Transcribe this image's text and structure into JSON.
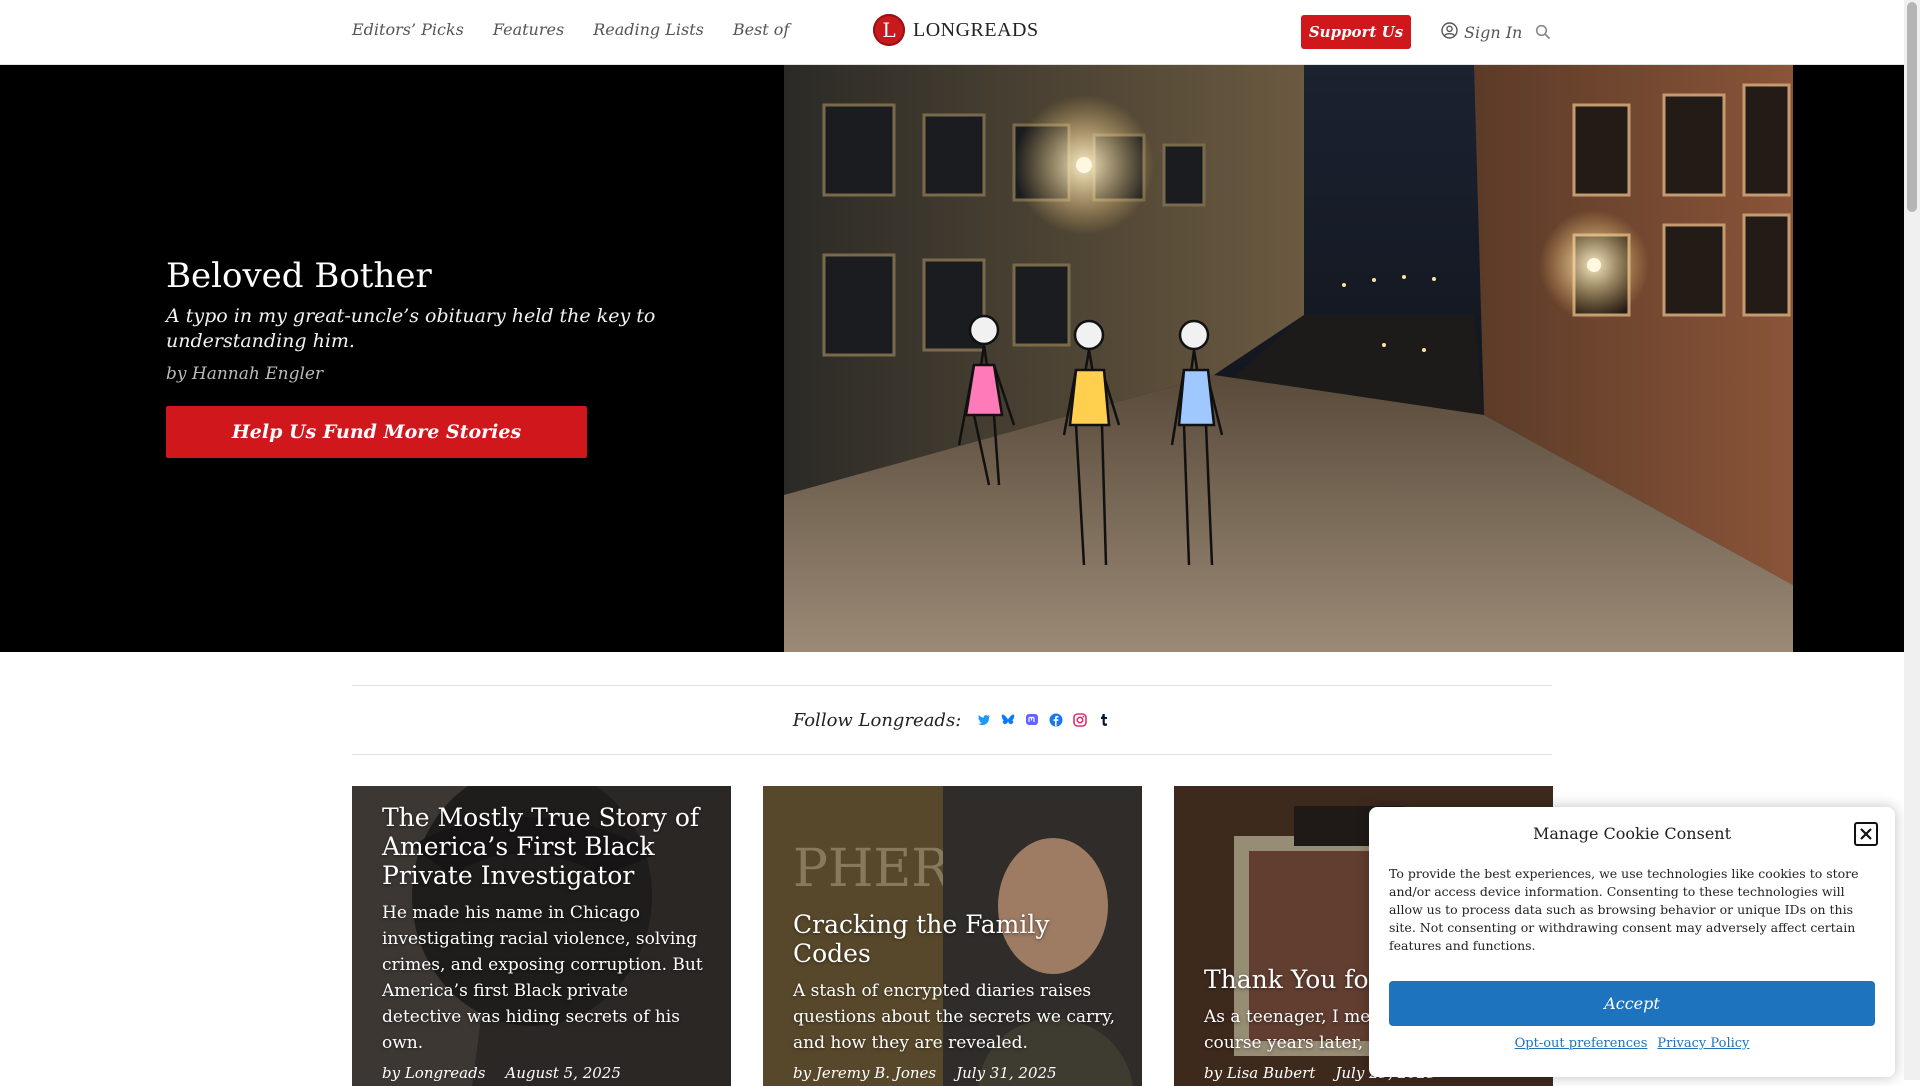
{
  "nav": {
    "links": [
      "Editors’ Picks",
      "Features",
      "Reading Lists",
      "Best of"
    ],
    "logo_letter": "L",
    "logo_text": "LONGREADS",
    "support_label": "Support Us",
    "signin_label": "Sign In"
  },
  "hero": {
    "title": "Beloved Bother",
    "dek": "A typo in my great-uncle’s obituary held the key to understanding him.",
    "byline": "by Hannah Engler",
    "cta_label": "Help Us Fund More Stories"
  },
  "follow": {
    "label": "Follow Longreads:",
    "icons": [
      "twitter-icon",
      "bluesky-icon",
      "mastodon-icon",
      "facebook-icon",
      "instagram-icon",
      "tumblr-icon"
    ]
  },
  "cards": [
    {
      "title": "The Mostly True Story of America’s First Black Private Investigator",
      "dek": "He made his name in Chicago investigating racial violence, solving crimes, and exposing corruption. But America’s first Black private detective was hiding secrets of his own.",
      "author": "by Longreads",
      "date": "August 5, 2025"
    },
    {
      "title": "Cracking the Family Codes",
      "dek": "A stash of encrypted diaries raises questions about the secrets we carry, and how they are revealed.",
      "author": "by Jeremy B. Jones",
      "date": "July 31, 2025",
      "image_text": "PHER"
    },
    {
      "title": "Thank You for",
      "dek": "As a teenager, I met changed the course years later, I went lo",
      "author": "by Lisa Bubert",
      "date": "July 29, 2025"
    }
  ],
  "cookie": {
    "title": "Manage Cookie Consent",
    "text": "To provide the best experiences, we use technologies like cookies to store and/or access device information. Consenting to these technologies will allow us to process data such as browsing behavior or unique IDs on this site. Not consenting or withdrawing consent may adversely affect certain features and functions.",
    "accept_label": "Accept",
    "optout_label": "Opt-out preferences",
    "privacy_label": "Privacy Policy"
  },
  "colors": {
    "brand_red": "#d0181c",
    "accept_blue": "#1e73be"
  }
}
